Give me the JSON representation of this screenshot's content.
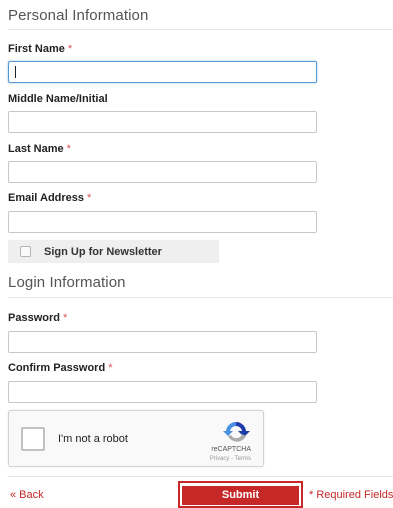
{
  "personal": {
    "title": "Personal Information",
    "first_name_label": "First Name",
    "middle_name_label": "Middle Name/Initial",
    "last_name_label": "Last Name",
    "email_label": "Email Address",
    "required_marker": "*",
    "newsletter_label": "Sign Up for Newsletter"
  },
  "login": {
    "title": "Login Information",
    "password_label": "Password",
    "confirm_password_label": "Confirm Password",
    "required_marker": "*"
  },
  "captcha": {
    "label": "I'm not a robot",
    "brand": "reCAPTCHA",
    "terms": "Privacy - Terms"
  },
  "footer": {
    "back_label": "« Back",
    "submit_label": "Submit",
    "required_note": "* Required Fields"
  },
  "colors": {
    "accent": "#c62828",
    "focus": "#5b9bd5"
  }
}
